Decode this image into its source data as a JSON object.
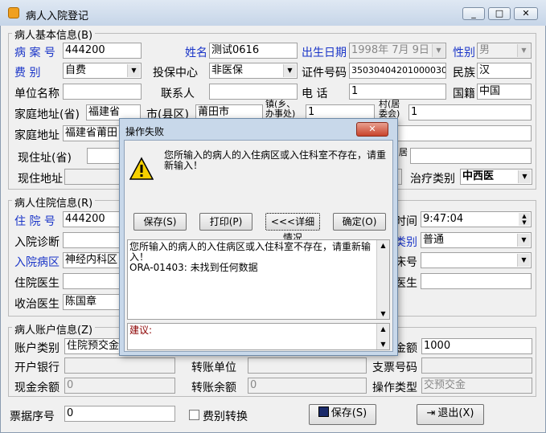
{
  "window": {
    "title": "病人入院登记",
    "min_icon": "minimize-icon",
    "max_icon": "maximize-icon",
    "close_icon": "close-icon",
    "close_glyph": "✕",
    "max_glyph": "□",
    "min_glyph": "_"
  },
  "basic": {
    "group_title": "病人基本信息(B)",
    "record_no_label": "病 案 号",
    "record_no": "444200",
    "name_label": "姓名",
    "name": "测试0616",
    "birth_label": "出生日期",
    "birth": "1998年 7月 9日",
    "sex_label": "性别",
    "sex": "男",
    "fee_label": "费    别",
    "fee": "自费",
    "insure_label": "投保中心",
    "insure": "非医保",
    "id_type_label": "证件号码",
    "id_no": "350304042010000300",
    "nation_label": "民族",
    "nation": "汉",
    "employer_label": "单位名称",
    "employer": "",
    "contact_label": "联系人",
    "contact": "",
    "phone_label": "电    话",
    "phone": "1",
    "nationality_label": "国籍",
    "nationality": "中国",
    "home_prov_label": "家庭地址(省)",
    "home_prov": "福建省",
    "home_city_label": "市(县区)",
    "home_city": "莆田市",
    "home_town_label": "镇(乡、办事处)",
    "home_town": "1",
    "home_village_label": "村(居委会)",
    "home_village": "1",
    "home_addr_label": "家庭地址",
    "home_addr": "福建省莆田",
    "cur_prov_label": "现住址(省)",
    "cur_prov": "",
    "cur_village_label": "居",
    "cur_village": "",
    "cur_addr_label": "现住地址",
    "cur_addr": "",
    "treat_label": "治疗类别",
    "treat": "中西医"
  },
  "hosp": {
    "group_title": "病人住院信息(R)",
    "no_label": "住 院 号",
    "no": "444200",
    "time_label": "时间",
    "time": "9:47:04",
    "diag_label": "入院诊断",
    "diag": "",
    "type_label": "类别",
    "type": "普通",
    "ward_label": "入院病区",
    "ward": "神经内科区",
    "bed_label": "床号",
    "bed": "",
    "doctor_label": "住院医生",
    "doctor": "",
    "doctor2_label": "医生",
    "doctor2": "",
    "receiver_label": "收治医生",
    "receiver": "陈国章"
  },
  "account": {
    "group_title": "病人账户信息(Z)",
    "acct_type_label": "账户类别",
    "acct_type": "住院预交金",
    "amount_label": "金额",
    "amount": "1000",
    "bank_label": "开户银行",
    "bank": "",
    "transfer_unit_label": "转账单位",
    "transfer_unit": "",
    "cheque_label": "支票号码",
    "cheque": "",
    "cash_label": "现金余额",
    "cash": "0",
    "transfer_bal_label": "转账余额",
    "transfer_bal": "0",
    "op_type_label": "操作类型",
    "op_type": "交预交金"
  },
  "footer": {
    "bill_label": "票据序号",
    "bill": "0",
    "fee_switch_label": "费别转换",
    "save_label": "保存(S)",
    "exit_label": "退出(X)"
  },
  "dialog": {
    "title": "操作失败",
    "message": "您所输入的病人的入住病区或入住科室不存在，请重新输入！",
    "btn_save": "保存(S)",
    "btn_print": "打印(P)",
    "btn_detail": "<<<详细情况",
    "btn_ok": "确定(O)",
    "detail_line1": "您所输入的病人的入住病区或入住科室不存在，请重新输入！",
    "detail_line2": "ORA-01403: 未找到任何数据",
    "advice_label": "建议:"
  }
}
